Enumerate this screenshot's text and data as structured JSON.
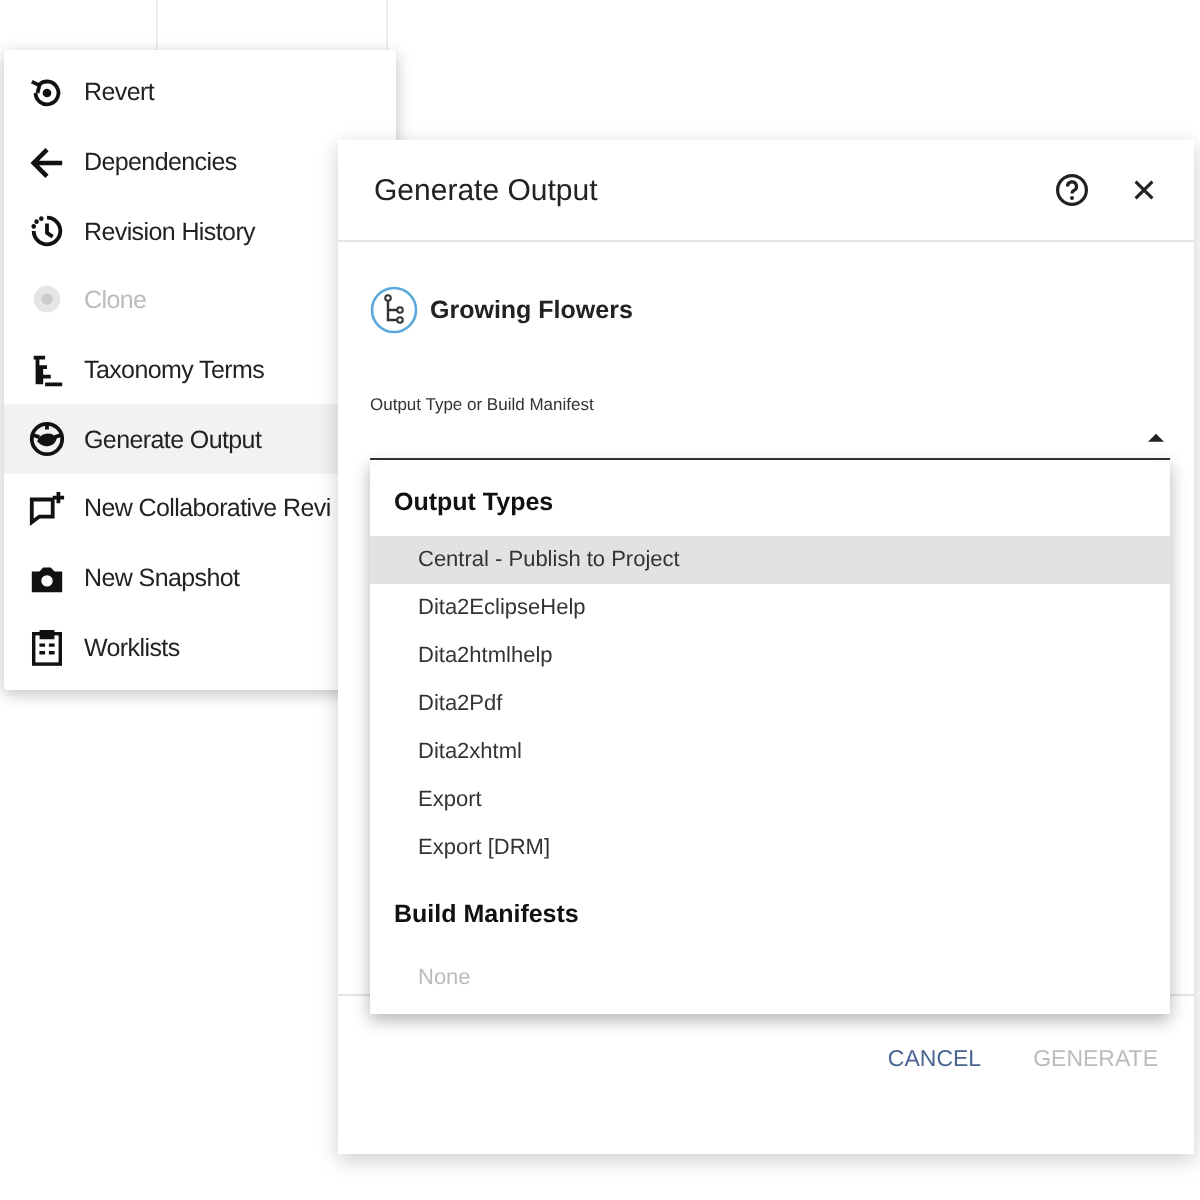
{
  "menu": {
    "items": [
      {
        "label": "Revert",
        "disabled": false,
        "selected": false
      },
      {
        "label": "Dependencies",
        "disabled": false,
        "selected": false
      },
      {
        "label": "Revision History",
        "disabled": false,
        "selected": false
      },
      {
        "label": "Clone",
        "disabled": true,
        "selected": false
      },
      {
        "label": "Taxonomy Terms",
        "disabled": false,
        "selected": false
      },
      {
        "label": "Generate Output",
        "disabled": false,
        "selected": true
      },
      {
        "label": "New Collaborative Revi",
        "disabled": false,
        "selected": false
      },
      {
        "label": "New Snapshot",
        "disabled": false,
        "selected": false
      },
      {
        "label": "Worklists",
        "disabled": false,
        "selected": false
      }
    ]
  },
  "dialog": {
    "title": "Generate Output",
    "document": {
      "title": "Growing Flowers"
    },
    "field": {
      "label": "Output Type or Build Manifest",
      "expanded": true
    },
    "dropdown": {
      "groups": [
        {
          "heading": "Output Types",
          "options": [
            {
              "label": "Central - Publish to Project",
              "selected": true,
              "disabled": false
            },
            {
              "label": "Dita2EclipseHelp",
              "selected": false,
              "disabled": false
            },
            {
              "label": "Dita2htmlhelp",
              "selected": false,
              "disabled": false
            },
            {
              "label": "Dita2Pdf",
              "selected": false,
              "disabled": false
            },
            {
              "label": "Dita2xhtml",
              "selected": false,
              "disabled": false
            },
            {
              "label": "Export",
              "selected": false,
              "disabled": false
            },
            {
              "label": "Export [DRM]",
              "selected": false,
              "disabled": false
            }
          ]
        },
        {
          "heading": "Build Manifests",
          "options": [
            {
              "label": "None",
              "selected": false,
              "disabled": true
            }
          ]
        }
      ]
    },
    "buttons": [
      {
        "label": "CANCEL",
        "disabled": false
      },
      {
        "label": "GENERATE",
        "disabled": true
      }
    ]
  }
}
